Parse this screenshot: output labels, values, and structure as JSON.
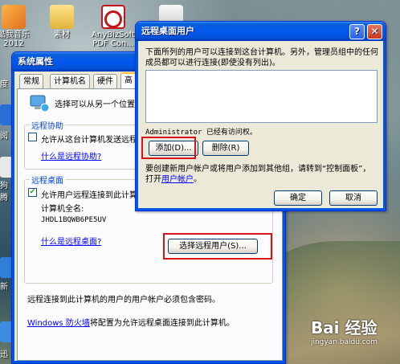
{
  "desktop": {
    "icons": [
      {
        "label": "酷我音乐\n2012",
        "icon": "music-app-icon"
      },
      {
        "label": "素材",
        "icon": "folder-icon"
      },
      {
        "label": "AnyBizSoft\nPDF Con...",
        "icon": "pdf-converter-icon"
      }
    ],
    "left_labels": [
      "度",
      "阅",
      "i",
      "狗\n腾",
      "讯",
      "腾",
      "新",
      "迅"
    ]
  },
  "system_properties": {
    "title": "系统属性",
    "tabs": [
      "常规",
      "计算机名",
      "硬件",
      "高"
    ],
    "intro_text": "选择可以从另一个位置使",
    "remote_assistance": {
      "group_label": "远程协助",
      "checkbox_label": "允许从这台计算机发送远程",
      "checked": false,
      "link": "什么是远程协助?"
    },
    "remote_desktop": {
      "group_label": "远程桌面",
      "checkbox_label": "允许用户远程连接到此计算",
      "checked": true,
      "computer_name_label": "计算机全名:",
      "computer_name": "JHDL1BQWB6PE5UV",
      "link": "什么是远程桌面?",
      "select_users_button": "选择远程用户(S)..."
    },
    "password_note": "远程连接到此计算机的用户的用户帐户必须包含密码。",
    "firewall_link": "Windows 防火墙",
    "firewall_text": "将配置为允许远程桌面连接到此计算机。"
  },
  "remote_users_dialog": {
    "title": "远程桌面用户",
    "help_label": "?",
    "close_label": "✕",
    "description_line1": "下面所列的用户可以连接到这台计算机。另外，管理员组中的任何",
    "description_line2": "成员都可以进行连接(即使没有列出)。",
    "user_list": [],
    "access_note": "Administrator 已经有访问权。",
    "add_button": "添加(D)...",
    "remove_button": "删除(R)",
    "info_line1": "要创建新用户帐户或将用户添加到其他组，请转到“控制面板”，",
    "info_prefix": "打开",
    "info_link": "用户帐户",
    "info_suffix": "。",
    "ok_button": "确定",
    "cancel_button": "取消"
  },
  "watermark": {
    "logo": "Bai 经验",
    "url": "jingyan.baidu.com"
  },
  "colors": {
    "title_bar": "#0058ee",
    "highlight_box": "#d8141c",
    "link": "#0000ff",
    "window_bg": "#ece9d8"
  }
}
